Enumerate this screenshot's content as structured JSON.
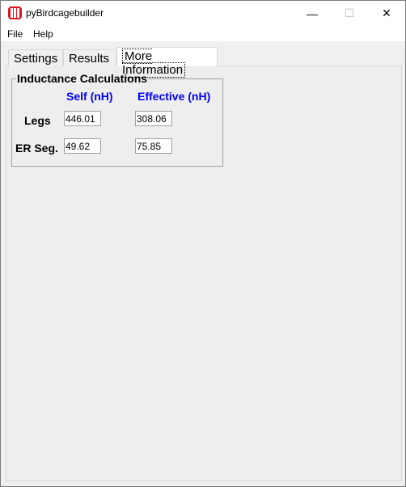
{
  "window": {
    "title": "pyBirdcagebuilder",
    "minimize": "—",
    "maximize": "☐",
    "close": "✕"
  },
  "menu": [
    "File",
    "Help"
  ],
  "tabs": [
    "Settings",
    "Results",
    "More Information"
  ],
  "group": {
    "title": "Inductance Calculations",
    "col_self": "Self (nH)",
    "col_eff": "Effective (nH)",
    "rows": [
      {
        "label": "Legs",
        "self": "446.01",
        "eff": "308.06"
      },
      {
        "label": "ER Seg.",
        "self": "49.62",
        "eff": "75.85"
      }
    ]
  }
}
